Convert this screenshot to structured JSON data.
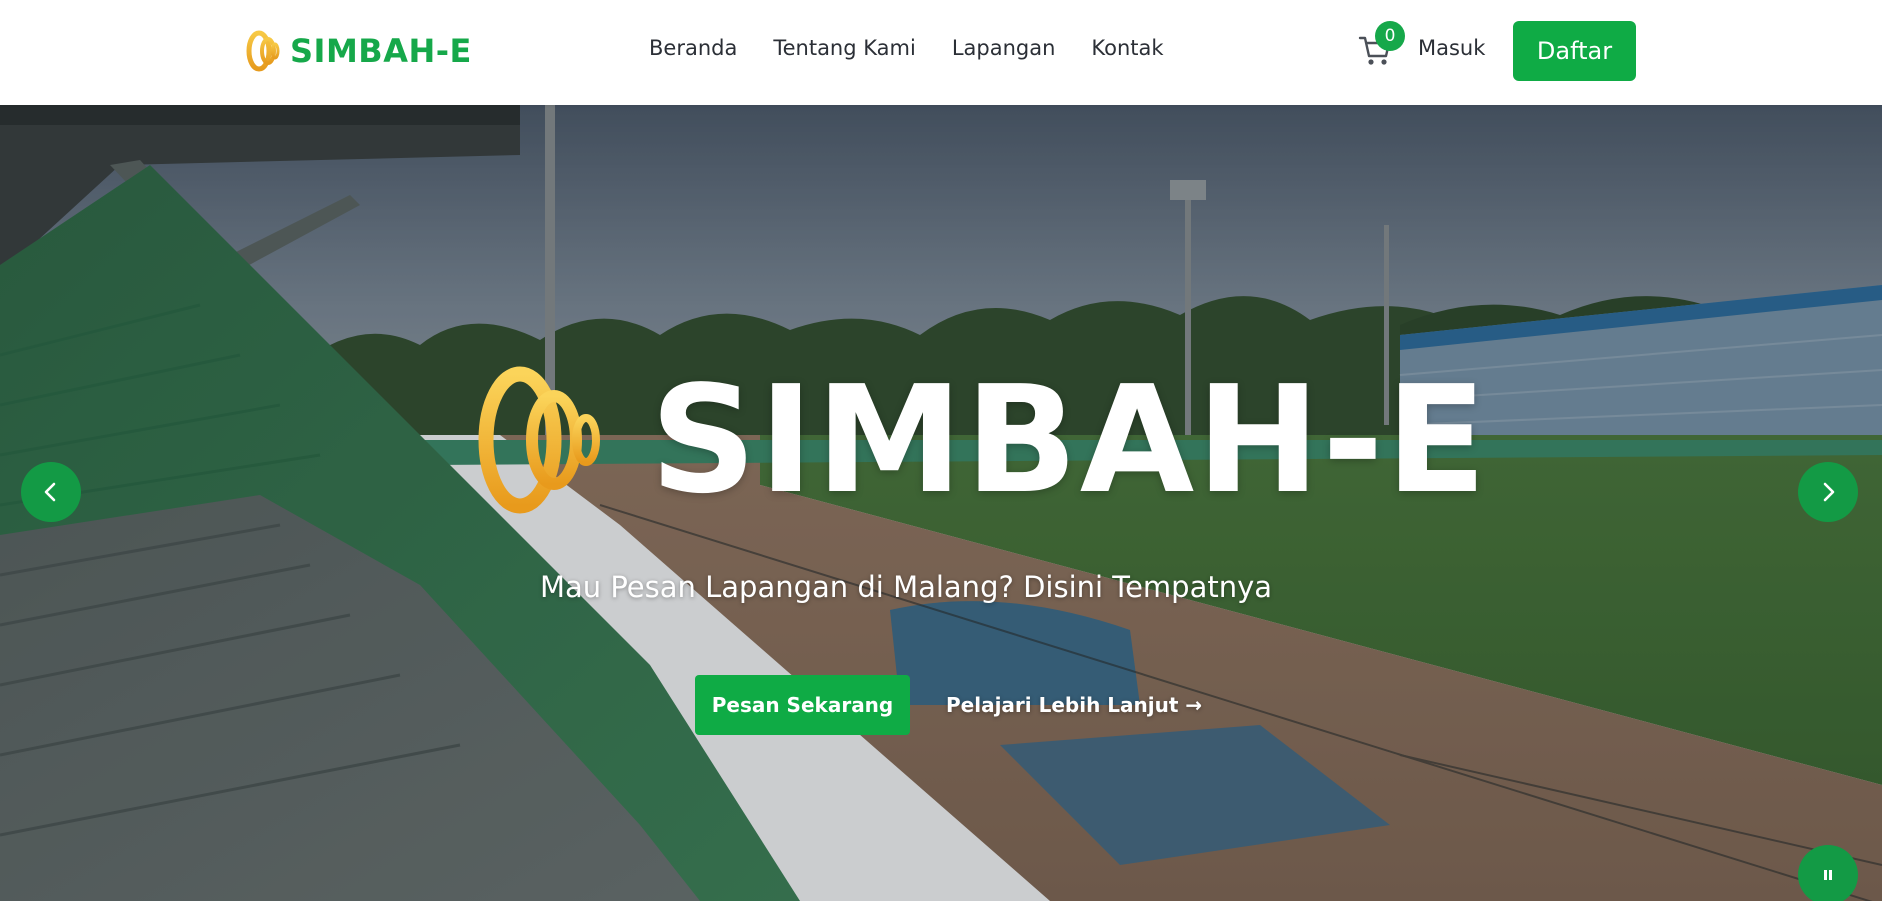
{
  "header": {
    "brand": "SIMBAH-E",
    "nav": [
      {
        "label": "Beranda"
      },
      {
        "label": "Tentang Kami"
      },
      {
        "label": "Lapangan"
      },
      {
        "label": "Kontak"
      }
    ],
    "cart_count": "0",
    "login_label": "Masuk",
    "register_label": "Daftar"
  },
  "hero": {
    "title": "SIMBAH-E",
    "subtitle": "Mau Pesan Lapangan di Malang? Disini Tempatnya",
    "primary_cta": "Pesan Sekarang",
    "secondary_cta": "Pelajari Lebih Lanjut →"
  },
  "icons": {
    "logo": "simbah-e-logo-mark",
    "cart": "cart-icon",
    "prev": "chevron-left-icon",
    "next": "chevron-right-icon",
    "pause": "pause-icon"
  },
  "colors": {
    "brand_green": "#16a84a",
    "button_green": "#0fab45",
    "logo_gold": "#f2b52a",
    "nav_text": "#2b2f36"
  }
}
